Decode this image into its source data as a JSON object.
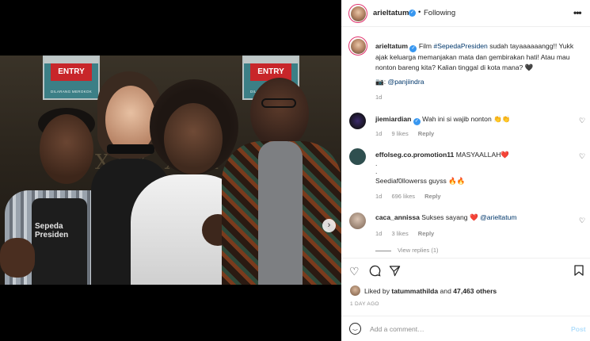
{
  "post": {
    "author": "arieltatum",
    "follow_status": "Following",
    "separator": "•",
    "more_icon": "more-icon",
    "caption_author": "arieltatum",
    "caption_text_1": "Film ",
    "caption_hashtag": "#SepedaPresiden",
    "caption_text_2": " sudah tayaaaaaangg!! Yukk ajak keluarga memanjakan mata dan gembirakan hati! Atau mau nonton bareng kita? Kalian tinggal di kota mana? 🖤",
    "photo_credit_emoji": "📷",
    "photo_credit_sep": ":",
    "photo_credit_handle": "@panjiindra",
    "caption_time": "1d"
  },
  "media": {
    "signs": [
      "ENTRY",
      "ENTRY"
    ],
    "sign_sub": "DILARANG MEROKOK",
    "wall_text": "XXX XXX",
    "shirt_text": "Sepeda Presiden",
    "carousel_count": 4,
    "carousel_active": 1
  },
  "comments": [
    {
      "user": "jiemiardian",
      "verified": true,
      "text": "Wah ini si wajib nonton 👏👏",
      "time": "1d",
      "likes": "9 likes",
      "reply": "Reply"
    },
    {
      "user": "effolseg.co.promotion11",
      "verified": false,
      "text_line1": "MASYAALLAH❤️",
      "text_line2": ".",
      "text_line3": ".",
      "text_line4": "Seediaf0llowerss guyss 🔥🔥",
      "time": "1d",
      "likes": "696 likes",
      "reply": "Reply"
    },
    {
      "user": "caca_annissa",
      "verified": false,
      "text": "Sukses sayang ❤️ ",
      "mention": "@arieltatum",
      "time": "1d",
      "likes": "3 likes",
      "reply": "Reply",
      "view_replies": "View replies (1)"
    }
  ],
  "actions": {
    "liked_prefix": "Liked by ",
    "liked_user": "tatummathilda",
    "liked_and": " and ",
    "liked_others": "47,463 others",
    "timestamp": "1 DAY AGO"
  },
  "add_comment": {
    "placeholder": "Add a comment…",
    "post_label": "Post"
  },
  "colors": {
    "link": "#00376b",
    "verified": "#3897f0",
    "post_button_disabled": "#b2dffc",
    "story_ring": "#e1306c"
  }
}
